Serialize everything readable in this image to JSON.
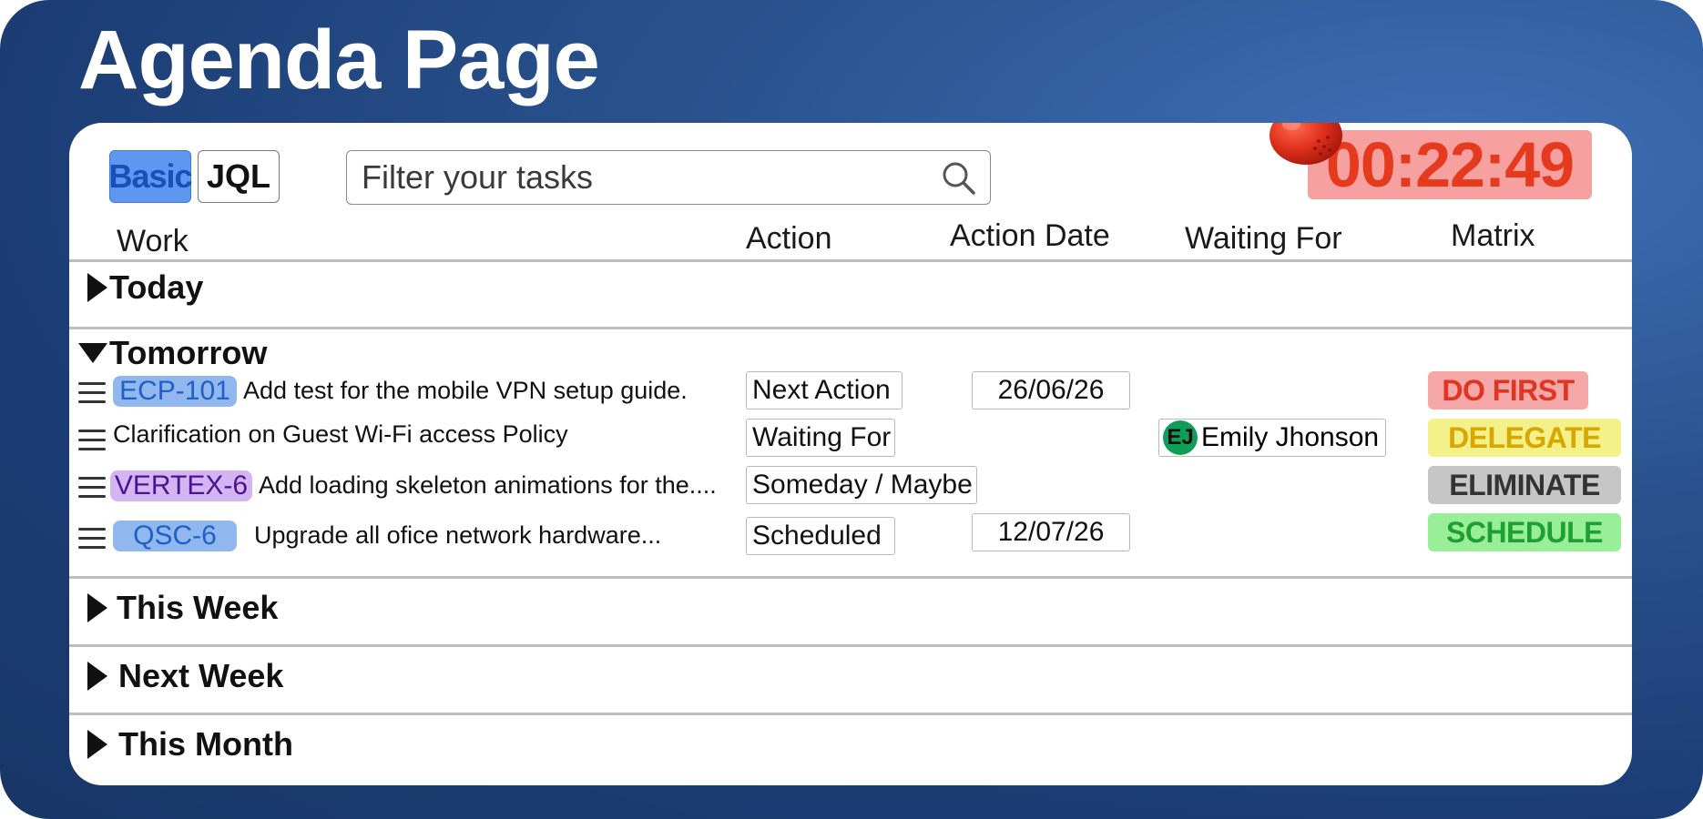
{
  "page_title": "Agenda Page",
  "toolbar": {
    "basic_label": "Basic",
    "jql_label": "JQL",
    "search_placeholder": "Filter your tasks",
    "timer": "00:22:49"
  },
  "columns": {
    "work": "Work",
    "action": "Action",
    "action_date": "Action Date",
    "waiting_for": "Waiting For",
    "matrix": "Matrix"
  },
  "sections": {
    "today": "Today",
    "tomorrow": "Tomorrow",
    "this_week": "This Week",
    "next_week": "Next Week",
    "this_month": "This Month"
  },
  "tasks": [
    {
      "key": "ECP-101",
      "title": "Add test for the mobile VPN setup guide.",
      "action": "Next Action",
      "date": "26/06/26",
      "matrix": "DO FIRST"
    },
    {
      "title": "Clarification on Guest Wi-Fi access Policy",
      "action": "Waiting For",
      "waiting_initials": "EJ",
      "waiting_name": "Emily Jhonson",
      "matrix": "DELEGATE"
    },
    {
      "key": "VERTEX-6",
      "title": "Add loading skeleton animations for the....",
      "action": "Someday / Maybe",
      "matrix": "ELIMINATE"
    },
    {
      "key": "QSC-6",
      "title": "Upgrade all ofice network hardware...",
      "action": "Scheduled",
      "date": "12/07/26",
      "matrix": "SCHEDULE"
    }
  ],
  "colors": {
    "background": "#1c3d75",
    "timer_bg": "#f6a0a0",
    "timer_text": "#e63a1f",
    "basic_active": "#5d97f0",
    "do_first": "#f6a7a7",
    "delegate": "#f4f08a",
    "eliminate": "#c6c6c6",
    "schedule": "#98ef98"
  },
  "icons": {
    "search": "search-icon",
    "timer": "tomato-icon",
    "drag": "drag-handle-icon"
  }
}
